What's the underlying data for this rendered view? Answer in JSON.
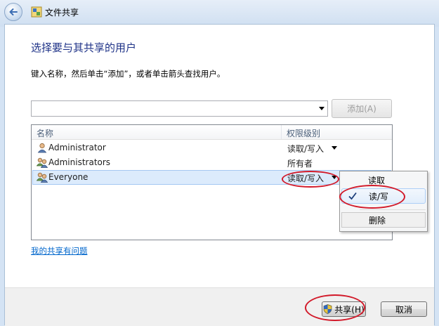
{
  "window": {
    "title": "文件共享",
    "back_icon": "back-arrow-icon",
    "app_icon": "file-sharing-icon"
  },
  "dialog": {
    "heading": "选择要与其共享的用户",
    "instruction": "键入名称，然后单击“添加”，或者单击箭头查找用户。",
    "name_input": {
      "value": "",
      "placeholder": ""
    },
    "add_button": "添加(A)",
    "columns": {
      "name": "名称",
      "permission": "权限级别"
    },
    "rows": [
      {
        "name": "Administrator",
        "permission": "读取/写入",
        "icon": "user-icon",
        "has_dropdown": true,
        "selected": false
      },
      {
        "name": "Administrators",
        "permission": "所有者",
        "icon": "user-group-icon",
        "has_dropdown": false,
        "selected": false
      },
      {
        "name": "Everyone",
        "permission": "读取/写入",
        "icon": "user-group-icon",
        "has_dropdown": true,
        "selected": true
      }
    ],
    "permission_menu": {
      "items": [
        {
          "label": "读取",
          "checked": false
        },
        {
          "label": "读/写",
          "checked": true
        },
        {
          "label": "删除",
          "checked": false
        }
      ]
    },
    "help_link": "我的共享有问题",
    "share_button": "共享(H)",
    "cancel_button": "取消"
  },
  "colors": {
    "heading": "#1e3287",
    "link": "#0066cc",
    "annotation": "#d21a2a",
    "selection": "#dcebfc"
  }
}
